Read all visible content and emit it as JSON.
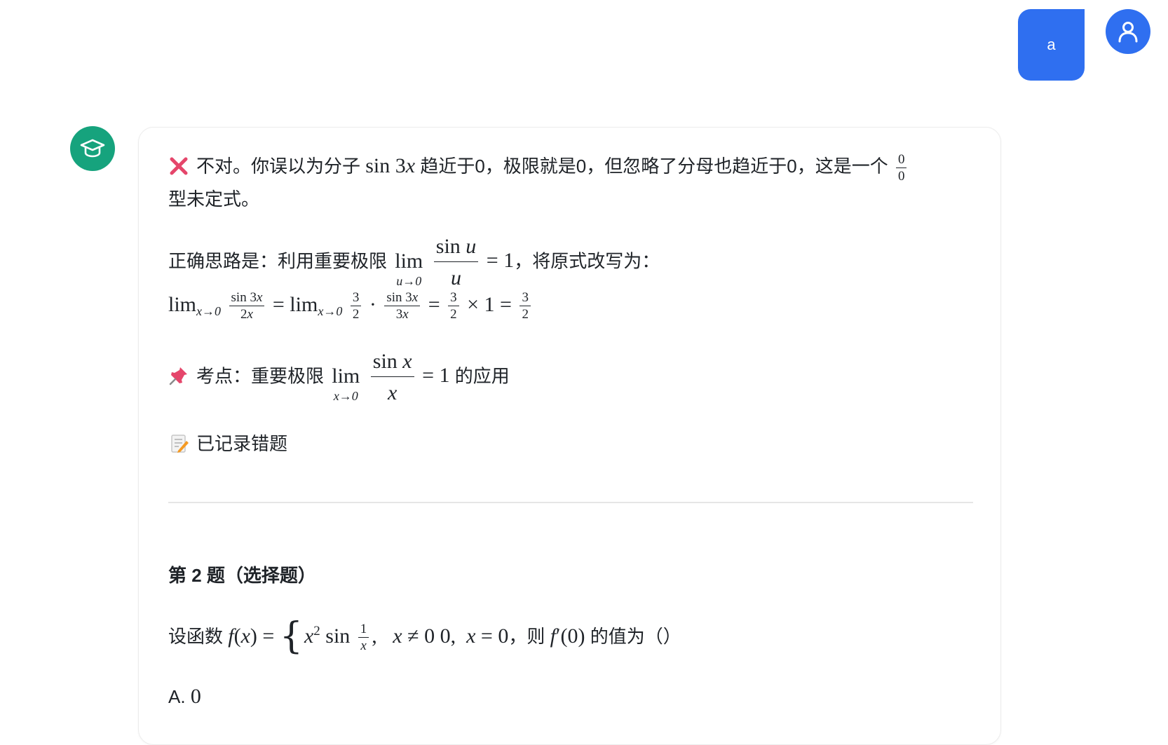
{
  "user_message": {
    "text": "a"
  },
  "feedback": {
    "line1_a": "不对。你误以为分子",
    "line1_b": "趋近于0，极限就是0，但忽略了分母也趋近于0，这是一个",
    "line1_c": "型未定式。",
    "line2_a": "正确思路是：利用重要极限",
    "line2_b": "，将原式改写为：",
    "keypoint_a": "考点：重要极限",
    "keypoint_b": "的应用",
    "recorded": "已记录错题"
  },
  "question": {
    "heading": "第 2 题（选择题）",
    "prefix": "设函数",
    "mid": "，则",
    "suffix": "的值为（）",
    "option_a_label": "A.",
    "option_a_value": "0"
  },
  "icons": {
    "user": "user-icon",
    "bot": "graduation-cap-icon",
    "wrong": "cross-mark-icon",
    "pin": "pushpin-icon",
    "memo": "memo-icon"
  },
  "colors": {
    "accent": "#2f6ff0",
    "bot": "#16a37d",
    "wrong": "#e5466b"
  }
}
